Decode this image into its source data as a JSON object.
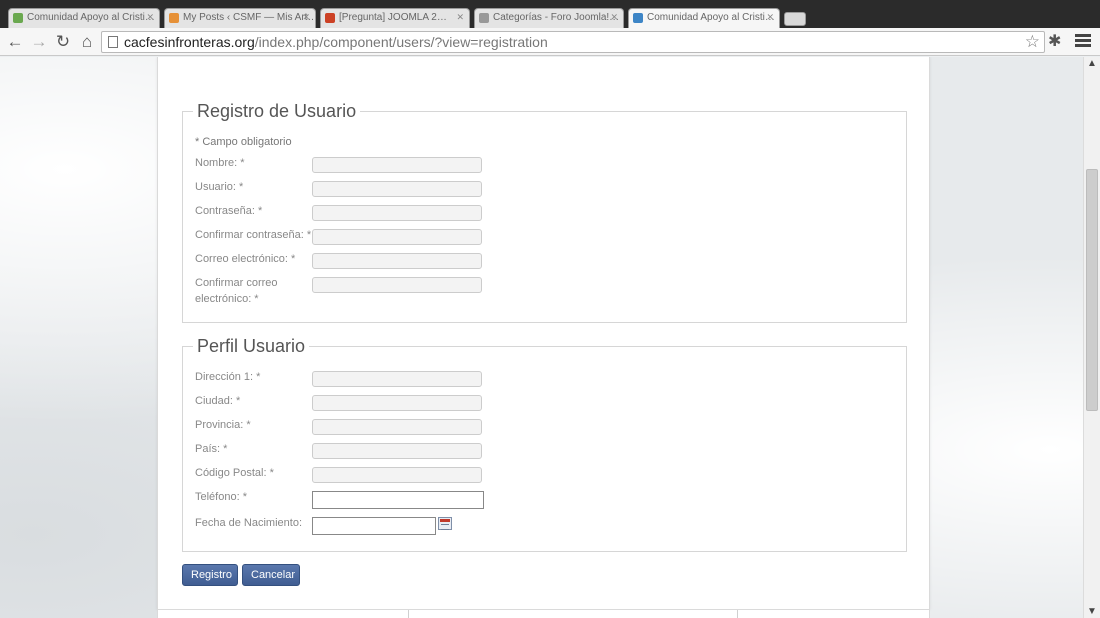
{
  "browser": {
    "tabs": [
      {
        "title": "Comunidad Apoyo al Cristi…",
        "favicon_color": "#6aa84f"
      },
      {
        "title": "My Posts ‹ CSMF — Mis Art…",
        "favicon_color": "#e69138"
      },
      {
        "title": "[Pregunta] JOOMLA 2…",
        "favicon_color": "#cc4125"
      },
      {
        "title": "Categorías - Foro Joomla!…",
        "favicon_color": "#999999"
      },
      {
        "title": "Comunidad Apoyo al Cristi…",
        "favicon_color": "#3d85c6"
      }
    ],
    "url_host": "cacfesinfronteras.org",
    "url_path": "/index.php/component/users/?view=registration"
  },
  "registration": {
    "legend": "Registro de Usuario",
    "required_note": "* Campo obligatorio",
    "fields": [
      {
        "label": "Nombre: *",
        "value": ""
      },
      {
        "label": "Usuario: *",
        "value": ""
      },
      {
        "label": "Contraseña: *",
        "value": ""
      },
      {
        "label": "Confirmar contraseña: *",
        "value": ""
      },
      {
        "label": "Correo electrónico: *",
        "value": ""
      },
      {
        "label": "Confirmar correo electrónico: *",
        "value": ""
      }
    ]
  },
  "profile": {
    "legend": "Perfil Usuario",
    "fields": [
      {
        "label": "Dirección 1: *",
        "value": ""
      },
      {
        "label": "Ciudad: *",
        "value": ""
      },
      {
        "label": "Provincia: *",
        "value": ""
      },
      {
        "label": "País: *",
        "value": ""
      },
      {
        "label": "Código Postal: *",
        "value": ""
      },
      {
        "label": "Teléfono: *",
        "value": ""
      },
      {
        "label": "Fecha de Nacimiento:",
        "value": ""
      }
    ]
  },
  "actions": {
    "submit_label": "Registro",
    "cancel_label": "Cancelar"
  },
  "colors": {
    "button": "#4a679c",
    "legend_text": "#555555"
  }
}
